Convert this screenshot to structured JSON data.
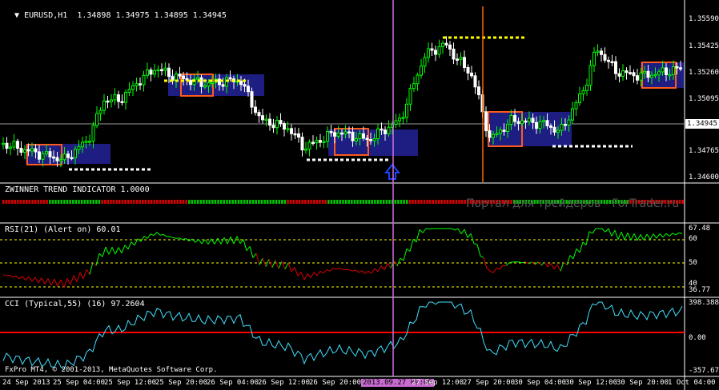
{
  "main_pane": {
    "symbol_caption": "EURUSD,H1  1.34898 1.34975 1.34895 1.34945",
    "current_price_tag": "1.34945"
  },
  "trend_pane": {
    "caption": "ZWINNER TREND INDICATOR 1.0000"
  },
  "rsi_pane": {
    "caption": "RSI(21) (Alert on) 60.01"
  },
  "cci_pane": {
    "caption": "CCI (Typical,55) (16) 97.2604"
  },
  "footer": {
    "copyright": "FxPro MT4, © 2001-2013, MetaQuotes Software Corp."
  },
  "watermark": "Портал для трейдеров - ForTrader.ru",
  "cursor_time": "2013.09.27 09:00",
  "colors": {
    "background": "#000000",
    "bull": "#00ff00",
    "bear": "#ffffff",
    "trend_up": "#00c800",
    "trend_down": "#dc0000",
    "zone_fill": "#1e1e82",
    "zone_border": "#ff5a1e",
    "resistance_line": "#ffff00",
    "support_line": "#ffffff",
    "crosshair_v": "#d070e0",
    "cci_line": "#40e0ff",
    "cci_zero": "#ff0000",
    "rsi_level": "#ffff00"
  },
  "chart_data": [
    {
      "type": "candlestick",
      "title": "EURUSD,H1",
      "y_ticks": [
        "1.35590",
        "1.35425",
        "1.35260",
        "1.35095",
        "1.34945",
        "1.34765",
        "1.34600"
      ],
      "ylim": [
        1.346,
        1.3559
      ],
      "x_ticks": [
        "24 Sep 2013",
        "25 Sep 04:00",
        "25 Sep 12:00",
        "25 Sep 20:00",
        "26 Sep 04:00",
        "26 Sep 12:00",
        "26 Sep 20:00",
        "2013.09.27 09:00",
        "27 Sep 12:00",
        "27 Sep 20:00",
        "30 Sep 04:00",
        "30 Sep 12:00",
        "30 Sep 20:00",
        "1 Oct 04:00"
      ],
      "last_price": 1.34945
    },
    {
      "type": "bar",
      "title": "ZWINNER TREND INDICATOR 1.0000",
      "series": [
        {
          "values": [
            "D",
            "D",
            "D",
            "D",
            "D",
            "D",
            "D",
            "D",
            "D",
            "D",
            "D",
            "D",
            "D",
            "D",
            "D",
            "D",
            "U",
            "U",
            "U",
            "U",
            "U",
            "U",
            "U",
            "U",
            "U",
            "U",
            "U",
            "U",
            "U",
            "U",
            "U",
            "U",
            "U",
            "U",
            "D",
            "D",
            "D",
            "D",
            "D",
            "D",
            "D",
            "D",
            "D",
            "D",
            "D",
            "D",
            "D",
            "D",
            "D",
            "D",
            "D",
            "D",
            "D",
            "D",
            "D",
            "D",
            "D",
            "D",
            "D",
            "D",
            "D",
            "D",
            "D",
            "D",
            "U",
            "U",
            "U",
            "U",
            "U",
            "U",
            "U",
            "U",
            "U",
            "U",
            "U",
            "U",
            "U",
            "U",
            "U",
            "U",
            "U",
            "U",
            "U",
            "U",
            "U",
            "U",
            "U",
            "U",
            "U",
            "U",
            "U",
            "U",
            "U",
            "U",
            "U",
            "U",
            "U",
            "U",
            "D",
            "D",
            "D",
            "D",
            "D",
            "D",
            "D",
            "D",
            "D",
            "D",
            "D",
            "D",
            "D",
            "D",
            "U",
            "U",
            "U",
            "U",
            "U",
            "U",
            "U",
            "U",
            "U",
            "U",
            "U",
            "U",
            "U",
            "U",
            "U",
            "U",
            "U",
            "U",
            "U",
            "U",
            "U",
            "U",
            "U",
            "U",
            "U",
            "U",
            "U",
            "U",
            "D",
            "D",
            "D",
            "D",
            "D",
            "D",
            "D",
            "D",
            "D",
            "D",
            "D",
            "D",
            "D",
            "D",
            "D",
            "D",
            "D",
            "D",
            "D",
            "D",
            "D",
            "D",
            "D",
            "D",
            "D",
            "D",
            "D",
            "D",
            "D",
            "D",
            "D",
            "D",
            "D",
            "D",
            "D",
            "D",
            "U",
            "U",
            "U",
            "U",
            "U",
            "U",
            "U",
            "U",
            "U",
            "U",
            "U",
            "U",
            "U",
            "U",
            "U",
            "U",
            "U",
            "U",
            "U",
            "U",
            "U",
            "U",
            "U",
            "U",
            "U",
            "U",
            "U",
            "U",
            "U",
            "U",
            "U",
            "U",
            "U",
            "U",
            "U",
            "U",
            "U",
            "U",
            "U",
            "U",
            "D",
            "D",
            "D",
            "D",
            "D",
            "D",
            "D",
            "D",
            "D",
            "D",
            "D",
            "D",
            "D",
            "D",
            "D",
            "D",
            "D",
            "D",
            "D"
          ]
        }
      ],
      "ylim": [
        0,
        1
      ]
    },
    {
      "type": "line",
      "title": "RSI(21) (Alert on) 60.01",
      "y_ticks": [
        "67.48",
        "60",
        "50",
        "40",
        "36.77"
      ],
      "ylim": [
        36.77,
        67.48
      ],
      "levels": [
        60,
        50,
        40
      ]
    },
    {
      "type": "line",
      "title": "CCI (Typical,55) (16) 97.2604",
      "y_ticks": [
        "398.388",
        "0.00",
        "-357.6717"
      ],
      "ylim": [
        -357.6717,
        398.388
      ],
      "level": 0
    }
  ]
}
